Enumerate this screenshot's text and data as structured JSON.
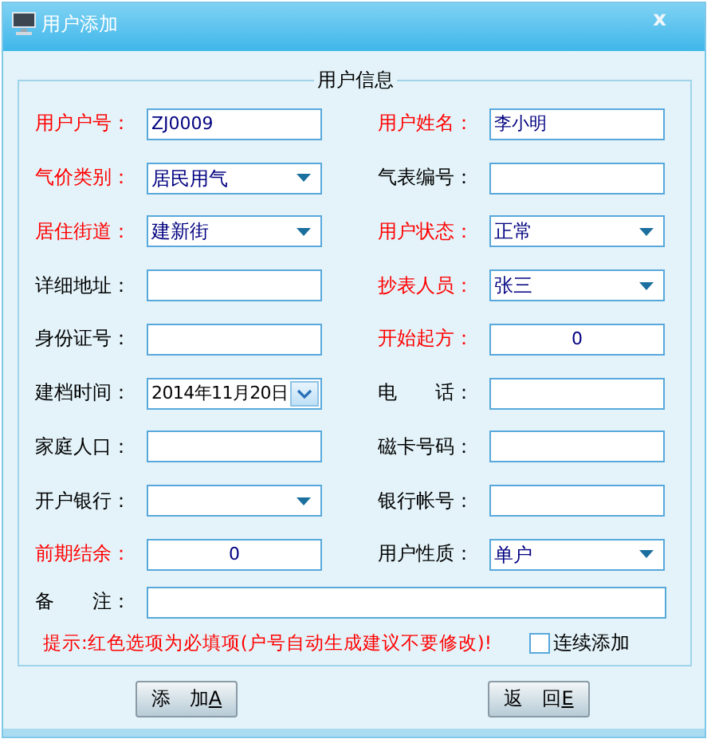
{
  "window": {
    "title": "用户添加",
    "close": "x"
  },
  "group": {
    "title": "用户信息"
  },
  "rows": [
    [
      {
        "label": "用户户号：",
        "required": true,
        "kind": "text",
        "value": "ZJ0009"
      },
      {
        "label": "用户姓名：",
        "required": true,
        "kind": "text",
        "value": "李小明"
      }
    ],
    [
      {
        "label": "气价类别：",
        "required": true,
        "kind": "select",
        "value": "居民用气"
      },
      {
        "label": "气表编号：",
        "required": false,
        "kind": "text"
      }
    ],
    [
      {
        "label": "居住街道：",
        "required": true,
        "kind": "select",
        "value": "建新街"
      },
      {
        "label": "用户状态：",
        "required": true,
        "kind": "select",
        "value": "正常"
      }
    ],
    [
      {
        "label": "详细地址：",
        "required": false,
        "kind": "text"
      },
      {
        "label": "抄表人员：",
        "required": true,
        "kind": "select",
        "value": "张三"
      }
    ],
    [
      {
        "label": "身份证号：",
        "required": false,
        "kind": "text"
      },
      {
        "label": "开始起方：",
        "required": true,
        "kind": "number",
        "value": "0"
      }
    ],
    [
      {
        "label": "建档时间：",
        "required": false,
        "kind": "date",
        "value": "2014年11月20日"
      },
      {
        "label": "电　　话：",
        "required": false,
        "kind": "text"
      }
    ],
    [
      {
        "label": "家庭人口：",
        "required": false,
        "kind": "text"
      },
      {
        "label": "磁卡号码：",
        "required": false,
        "kind": "text"
      }
    ],
    [
      {
        "label": "开户银行：",
        "required": false,
        "kind": "select"
      },
      {
        "label": "银行帐号：",
        "required": false,
        "kind": "text"
      }
    ],
    [
      {
        "label": "前期结余：",
        "required": true,
        "kind": "number",
        "value": "0"
      },
      {
        "label": "用户性质：",
        "required": false,
        "kind": "select",
        "value": "单户"
      }
    ]
  ],
  "remark": {
    "label": "备　　注："
  },
  "hint": "提示:红色选项为必填项(户号自动生成建议不要修改)!",
  "continuous": {
    "label": "连续添加",
    "checked": false
  },
  "buttons": [
    {
      "label": "添　加",
      "hotkey": "A"
    },
    {
      "label": "返　回",
      "hotkey": "E"
    }
  ]
}
